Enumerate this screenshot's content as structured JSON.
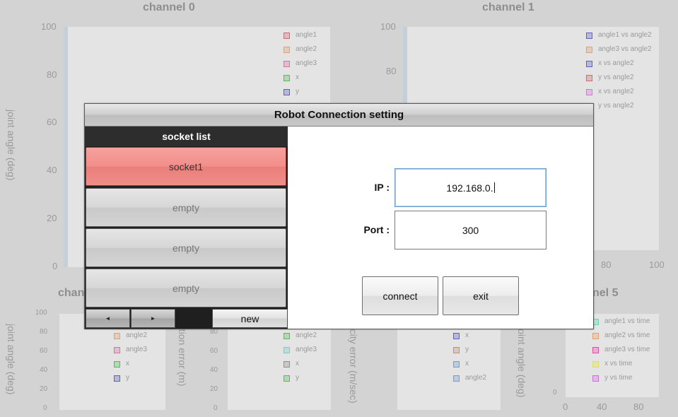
{
  "background": {
    "channel0": {
      "title": "channel 0",
      "ylabel": "joint angle (deg)",
      "yticks": [
        "100",
        "80",
        "60",
        "40",
        "20",
        "0"
      ],
      "legend": [
        {
          "label": "angle1",
          "color": "#e06666"
        },
        {
          "label": "angle2",
          "color": "#e0a070"
        },
        {
          "label": "angle3",
          "color": "#e070a0"
        },
        {
          "label": "x",
          "color": "#50c050"
        },
        {
          "label": "y",
          "color": "#6060d0"
        }
      ]
    },
    "channel1": {
      "title": "channel 1",
      "yticks": [
        "100",
        "80"
      ],
      "xticks": [
        "80",
        "100"
      ],
      "legend": [
        {
          "label": "angle1 vs angle2",
          "color": "#6060d0"
        },
        {
          "label": "angle3 vs angle2",
          "color": "#e0a070"
        },
        {
          "label": "x vs angle2",
          "color": "#6060d0"
        },
        {
          "label": "y vs angle2",
          "color": "#e06666"
        },
        {
          "label": "x vs angle2",
          "color": "#e070e0"
        },
        {
          "label": "y vs angle2",
          "color": "#cccccc"
        }
      ]
    },
    "channel2": {
      "title_partial": "chan",
      "ylabel": "joint angle (deg)",
      "yticks": [
        "100",
        "80",
        "60",
        "40",
        "20",
        "0"
      ],
      "legend": [
        {
          "label": "angle2",
          "color": "#e0a070"
        },
        {
          "label": "angle3",
          "color": "#e070a0"
        },
        {
          "label": "x",
          "color": "#50c050"
        },
        {
          "label": "y",
          "color": "#6060d0"
        }
      ]
    },
    "channel3": {
      "ylabel": "position error (m)",
      "yticks": [
        "80",
        "60",
        "40",
        "20",
        "0"
      ],
      "legend": [
        {
          "label": "angle2",
          "color": "#50c050"
        },
        {
          "label": "angle3",
          "color": "#70d0d0"
        },
        {
          "label": "x",
          "color": "#909090"
        },
        {
          "label": "y",
          "color": "#50c050"
        }
      ]
    },
    "channel4": {
      "ylabel": "velocity error (m/sec)",
      "legend": [
        {
          "label": "x",
          "color": "#6060d0"
        },
        {
          "label": "y",
          "color": "#c09070"
        },
        {
          "label": "x",
          "color": "#70a0d0"
        },
        {
          "label": "angle2",
          "color": "#70a0d0"
        }
      ]
    },
    "channel5": {
      "title_partial": "nel 5",
      "ylabel": "joint angle (deg)",
      "yticks": [
        "0"
      ],
      "xticks": [
        "0",
        "40",
        "80"
      ],
      "legend": [
        {
          "label": "angle1 vs time",
          "color": "#70d0b0"
        },
        {
          "label": "angle2 vs time",
          "color": "#e0a070"
        },
        {
          "label": "angle3 vs time",
          "color": "#e050a0"
        },
        {
          "label": "x vs time",
          "color": "#e0e060"
        },
        {
          "label": "y vs time",
          "color": "#d070e0"
        }
      ]
    }
  },
  "dialog": {
    "title": "Robot Connection setting",
    "socket_list": {
      "header": "socket list",
      "items": [
        {
          "label": "socket1",
          "selected": true
        },
        {
          "label": "empty",
          "selected": false
        },
        {
          "label": "empty",
          "selected": false
        },
        {
          "label": "empty",
          "selected": false
        }
      ],
      "prev_label": "◄",
      "next_label": "►",
      "new_label": "new"
    },
    "ip": {
      "label": "IP :",
      "value": "192.168.0."
    },
    "port": {
      "label": "Port :",
      "value": "300"
    },
    "connect_label": "connect",
    "exit_label": "exit"
  }
}
